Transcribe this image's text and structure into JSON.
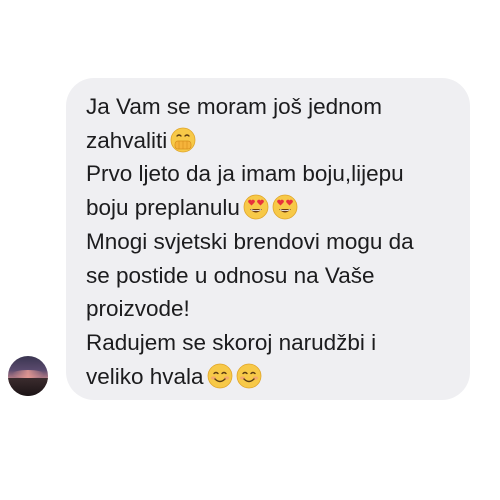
{
  "message": {
    "lines": [
      "Ja Vam se moram još jednom",
      "zahvaliti",
      "Prvo ljeto da ja imam boju,lijepu",
      "boju preplanulu",
      "Mnogi svjetski brendovi mogu da",
      "se postide u odnosu na Vaše",
      "proizvode!",
      "Radujem se skoroj narudžbi i",
      "veliko hvala"
    ],
    "emojis": {
      "line_2": [
        "face-with-hand-over-mouth-icon"
      ],
      "line_4": [
        "heart-eyes-icon",
        "heart-eyes-icon"
      ],
      "line_9": [
        "smiling-face-icon",
        "smiling-face-icon"
      ]
    },
    "bubble_color": "#efeff2",
    "text_color": "#1c1c1e"
  },
  "sender": {
    "avatar": "profile-photo-sunset"
  }
}
